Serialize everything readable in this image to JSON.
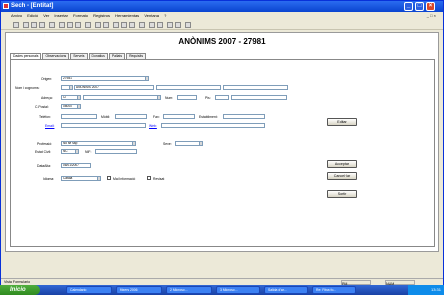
{
  "window": {
    "title": "Sech - [Entitat]"
  },
  "menu": [
    "Arxivo",
    "Edició",
    "Ver",
    "Insertar",
    "Formato",
    "Registros",
    "Herramientas",
    "Ventana",
    "?"
  ],
  "document": {
    "title": "ANÒNIMS 2007  - 27981"
  },
  "tabs": [
    "Dades personals",
    "Observacions",
    "Serveis",
    "Donatius",
    "Pallats",
    "Requisits"
  ],
  "form": {
    "origen": {
      "label": "Origen:",
      "value": "27981"
    },
    "nom": {
      "label": "Nom i cognoms:",
      "value": "ANÒNIMS 2007"
    },
    "adreca": {
      "label": "Adreça:",
      "value": "C/"
    },
    "num": {
      "label": "Num:"
    },
    "pis": {
      "label": "Pis:"
    },
    "cpostal": {
      "label": "C.Postal:",
      "value": "08000"
    },
    "telefon": {
      "label": "Telèfon:"
    },
    "mobil": {
      "label": "Mòbil:"
    },
    "fax": {
      "label": "Fax:"
    },
    "establiment": {
      "label": "Establiment:"
    },
    "email": {
      "label": "Email:"
    },
    "web": {
      "label": "Web:"
    },
    "professio": {
      "label": "Professió:",
      "value": "No se sap"
    },
    "sexe": {
      "label": "Sexe:"
    },
    "estatcivil": {
      "label": "Estat Civil:",
      "value": "NC"
    },
    "nif": {
      "label": "NIF:"
    },
    "datalta": {
      "label": "DataAlta:",
      "value": "06/01/2007"
    },
    "idioma": {
      "label": "Idioma:",
      "value": "Català"
    },
    "no_informacio": {
      "label": "Mai Informació"
    },
    "revisat": {
      "label": "Revisat"
    }
  },
  "buttons": {
    "editar": "Editar",
    "acceptar": "Acceptar",
    "cancellar": "Cancel·lar",
    "sortir": "Sortir"
  },
  "status": {
    "left": "Vista Formulario",
    "mid": "PM",
    "right": "NUM"
  },
  "taskbar": {
    "start": "Inicio",
    "tasks": [
      "Calendario",
      "fitxers 2006",
      "2 Microso...",
      "3 Microso...",
      "Salida d'ar...",
      "Re: Fitxa fo..."
    ],
    "clock": "13:31"
  }
}
